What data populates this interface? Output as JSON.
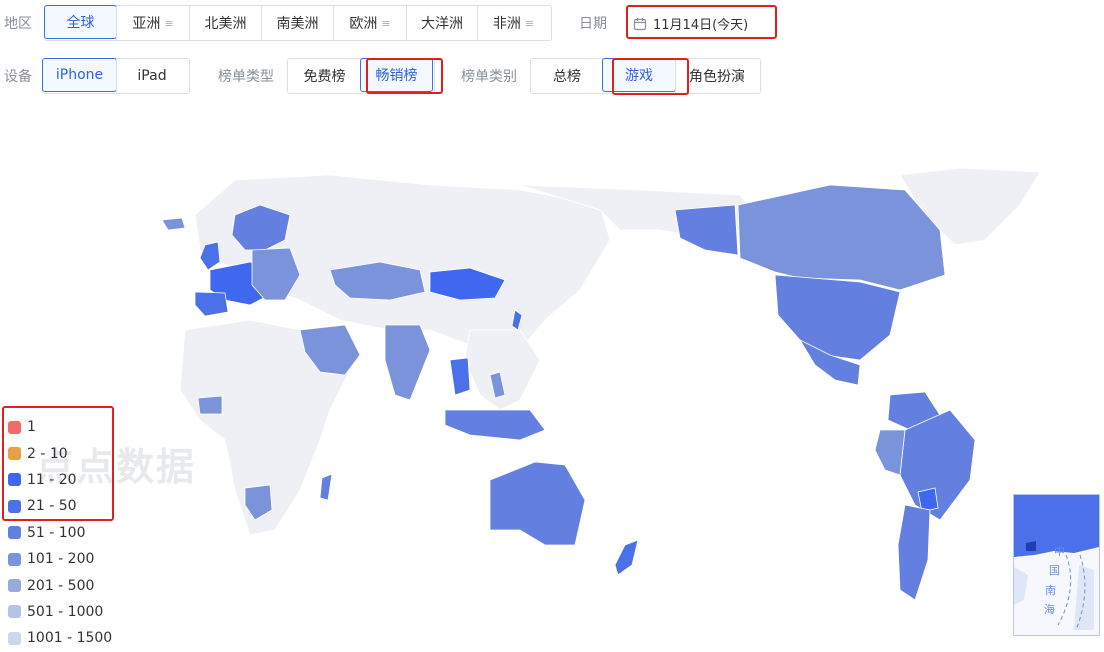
{
  "filters": {
    "region": {
      "label": "地区",
      "options": [
        {
          "label": "全球",
          "active": true,
          "menu": false
        },
        {
          "label": "亚洲",
          "active": false,
          "menu": true
        },
        {
          "label": "北美洲",
          "active": false,
          "menu": false
        },
        {
          "label": "南美洲",
          "active": false,
          "menu": false
        },
        {
          "label": "欧洲",
          "active": false,
          "menu": true
        },
        {
          "label": "大洋洲",
          "active": false,
          "menu": false
        },
        {
          "label": "非洲",
          "active": false,
          "menu": true
        }
      ],
      "menu_icon": "≡"
    },
    "date": {
      "label": "日期",
      "value": "11月14日(今天)",
      "icon": "calendar-icon"
    },
    "device": {
      "label": "设备",
      "options": [
        "iPhone",
        "iPad"
      ],
      "active": "iPhone"
    },
    "chart_type": {
      "label": "榜单类型",
      "options": [
        "免费榜",
        "畅销榜"
      ],
      "active": "畅销榜"
    },
    "chart_category": {
      "label": "榜单类别",
      "options": [
        "总榜",
        "游戏",
        "角色扮演"
      ],
      "active": "游戏"
    }
  },
  "watermark": "点点数据",
  "legend": [
    {
      "label": "1",
      "color": "#f26b6b"
    },
    {
      "label": "2 - 10",
      "color": "#e8a043"
    },
    {
      "label": "11 - 20",
      "color": "#3f67f0"
    },
    {
      "label": "21 - 50",
      "color": "#4a70ea"
    },
    {
      "label": "51 - 100",
      "color": "#637fe0"
    },
    {
      "label": "101 - 200",
      "color": "#7b93db"
    },
    {
      "label": "201 - 500",
      "color": "#98abdc"
    },
    {
      "label": "501 - 1000",
      "color": "#b4c3e6"
    },
    {
      "label": "1001 - 1500",
      "color": "#ccd7ee"
    }
  ],
  "inset": {
    "chars": [
      "中",
      "国",
      "南",
      "海"
    ]
  },
  "colors": {
    "accent": "#2f62dd",
    "highlight_box": "#e02020",
    "land_gray": "#eef0f5"
  }
}
